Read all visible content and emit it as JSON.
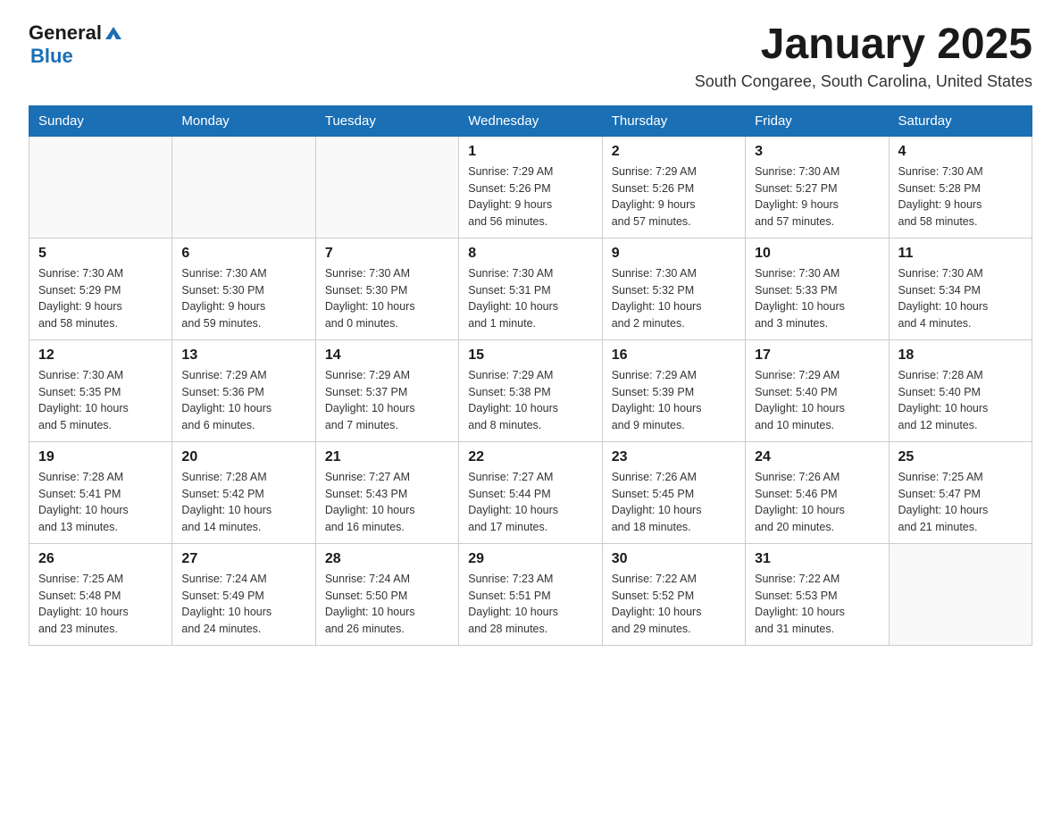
{
  "header": {
    "logo_general": "General",
    "logo_blue": "Blue",
    "month_title": "January 2025",
    "location": "South Congaree, South Carolina, United States"
  },
  "days_of_week": [
    "Sunday",
    "Monday",
    "Tuesday",
    "Wednesday",
    "Thursday",
    "Friday",
    "Saturday"
  ],
  "weeks": [
    [
      {
        "day": "",
        "info": ""
      },
      {
        "day": "",
        "info": ""
      },
      {
        "day": "",
        "info": ""
      },
      {
        "day": "1",
        "info": "Sunrise: 7:29 AM\nSunset: 5:26 PM\nDaylight: 9 hours\nand 56 minutes."
      },
      {
        "day": "2",
        "info": "Sunrise: 7:29 AM\nSunset: 5:26 PM\nDaylight: 9 hours\nand 57 minutes."
      },
      {
        "day": "3",
        "info": "Sunrise: 7:30 AM\nSunset: 5:27 PM\nDaylight: 9 hours\nand 57 minutes."
      },
      {
        "day": "4",
        "info": "Sunrise: 7:30 AM\nSunset: 5:28 PM\nDaylight: 9 hours\nand 58 minutes."
      }
    ],
    [
      {
        "day": "5",
        "info": "Sunrise: 7:30 AM\nSunset: 5:29 PM\nDaylight: 9 hours\nand 58 minutes."
      },
      {
        "day": "6",
        "info": "Sunrise: 7:30 AM\nSunset: 5:30 PM\nDaylight: 9 hours\nand 59 minutes."
      },
      {
        "day": "7",
        "info": "Sunrise: 7:30 AM\nSunset: 5:30 PM\nDaylight: 10 hours\nand 0 minutes."
      },
      {
        "day": "8",
        "info": "Sunrise: 7:30 AM\nSunset: 5:31 PM\nDaylight: 10 hours\nand 1 minute."
      },
      {
        "day": "9",
        "info": "Sunrise: 7:30 AM\nSunset: 5:32 PM\nDaylight: 10 hours\nand 2 minutes."
      },
      {
        "day": "10",
        "info": "Sunrise: 7:30 AM\nSunset: 5:33 PM\nDaylight: 10 hours\nand 3 minutes."
      },
      {
        "day": "11",
        "info": "Sunrise: 7:30 AM\nSunset: 5:34 PM\nDaylight: 10 hours\nand 4 minutes."
      }
    ],
    [
      {
        "day": "12",
        "info": "Sunrise: 7:30 AM\nSunset: 5:35 PM\nDaylight: 10 hours\nand 5 minutes."
      },
      {
        "day": "13",
        "info": "Sunrise: 7:29 AM\nSunset: 5:36 PM\nDaylight: 10 hours\nand 6 minutes."
      },
      {
        "day": "14",
        "info": "Sunrise: 7:29 AM\nSunset: 5:37 PM\nDaylight: 10 hours\nand 7 minutes."
      },
      {
        "day": "15",
        "info": "Sunrise: 7:29 AM\nSunset: 5:38 PM\nDaylight: 10 hours\nand 8 minutes."
      },
      {
        "day": "16",
        "info": "Sunrise: 7:29 AM\nSunset: 5:39 PM\nDaylight: 10 hours\nand 9 minutes."
      },
      {
        "day": "17",
        "info": "Sunrise: 7:29 AM\nSunset: 5:40 PM\nDaylight: 10 hours\nand 10 minutes."
      },
      {
        "day": "18",
        "info": "Sunrise: 7:28 AM\nSunset: 5:40 PM\nDaylight: 10 hours\nand 12 minutes."
      }
    ],
    [
      {
        "day": "19",
        "info": "Sunrise: 7:28 AM\nSunset: 5:41 PM\nDaylight: 10 hours\nand 13 minutes."
      },
      {
        "day": "20",
        "info": "Sunrise: 7:28 AM\nSunset: 5:42 PM\nDaylight: 10 hours\nand 14 minutes."
      },
      {
        "day": "21",
        "info": "Sunrise: 7:27 AM\nSunset: 5:43 PM\nDaylight: 10 hours\nand 16 minutes."
      },
      {
        "day": "22",
        "info": "Sunrise: 7:27 AM\nSunset: 5:44 PM\nDaylight: 10 hours\nand 17 minutes."
      },
      {
        "day": "23",
        "info": "Sunrise: 7:26 AM\nSunset: 5:45 PM\nDaylight: 10 hours\nand 18 minutes."
      },
      {
        "day": "24",
        "info": "Sunrise: 7:26 AM\nSunset: 5:46 PM\nDaylight: 10 hours\nand 20 minutes."
      },
      {
        "day": "25",
        "info": "Sunrise: 7:25 AM\nSunset: 5:47 PM\nDaylight: 10 hours\nand 21 minutes."
      }
    ],
    [
      {
        "day": "26",
        "info": "Sunrise: 7:25 AM\nSunset: 5:48 PM\nDaylight: 10 hours\nand 23 minutes."
      },
      {
        "day": "27",
        "info": "Sunrise: 7:24 AM\nSunset: 5:49 PM\nDaylight: 10 hours\nand 24 minutes."
      },
      {
        "day": "28",
        "info": "Sunrise: 7:24 AM\nSunset: 5:50 PM\nDaylight: 10 hours\nand 26 minutes."
      },
      {
        "day": "29",
        "info": "Sunrise: 7:23 AM\nSunset: 5:51 PM\nDaylight: 10 hours\nand 28 minutes."
      },
      {
        "day": "30",
        "info": "Sunrise: 7:22 AM\nSunset: 5:52 PM\nDaylight: 10 hours\nand 29 minutes."
      },
      {
        "day": "31",
        "info": "Sunrise: 7:22 AM\nSunset: 5:53 PM\nDaylight: 10 hours\nand 31 minutes."
      },
      {
        "day": "",
        "info": ""
      }
    ]
  ]
}
